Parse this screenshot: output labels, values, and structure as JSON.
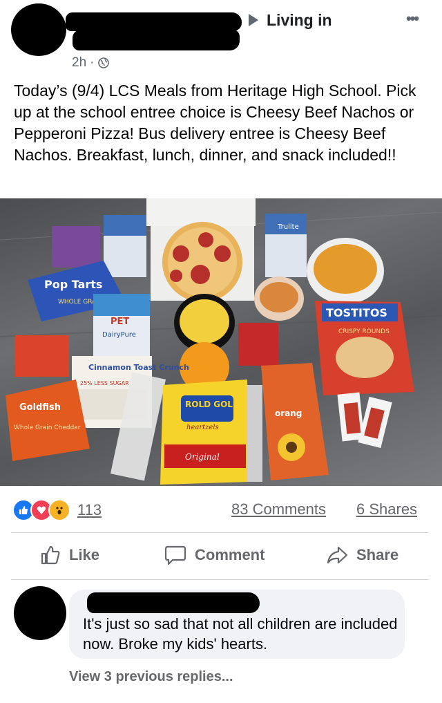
{
  "post": {
    "location": "Living in",
    "time": "2h",
    "separator": "·",
    "more": "•••",
    "text": "Today’s (9/4) LCS Meals from Heritage High School. Pick up at the school entree choice is Cheesy Beef Nachos or Pepperoni Pizza! Bus delivery entree is Cheesy Beef Nachos. Breakfast, lunch, dinner, and snack included!!"
  },
  "photo_labels": {
    "pop": "Pop Tarts",
    "pop_sub": "WHOLE GRAIN",
    "pet": "PET",
    "dairy": "DairyPure",
    "trulite": "Trulite",
    "cinnamon": "Cinnamon Toast Crunch",
    "less_sugar": "25% LESS SUGAR",
    "goldfish": "Goldfish",
    "goldfish_sub": "Whole Grain Cheddar",
    "rold": "ROLD GOLD",
    "hearts": "heartzels",
    "original": "Original",
    "tostitos": "TOSTITOS",
    "crispy": "CRISPY ROUNDS",
    "orange": "orang"
  },
  "engagement": {
    "reaction_count": "113",
    "comments": "83 Comments",
    "shares": "6 Shares"
  },
  "actions": {
    "like": "Like",
    "comment": "Comment",
    "share": "Share"
  },
  "comment": {
    "text": "It's just so sad that not all children are included now.  Broke my kids' hearts.",
    "view_replies": "View 3 previous replies..."
  },
  "colors": {
    "like_blue": "#1877f2",
    "love_red": "#f33e58",
    "wow_yellow": "#f7b125",
    "secondary_text": "#65676b"
  }
}
